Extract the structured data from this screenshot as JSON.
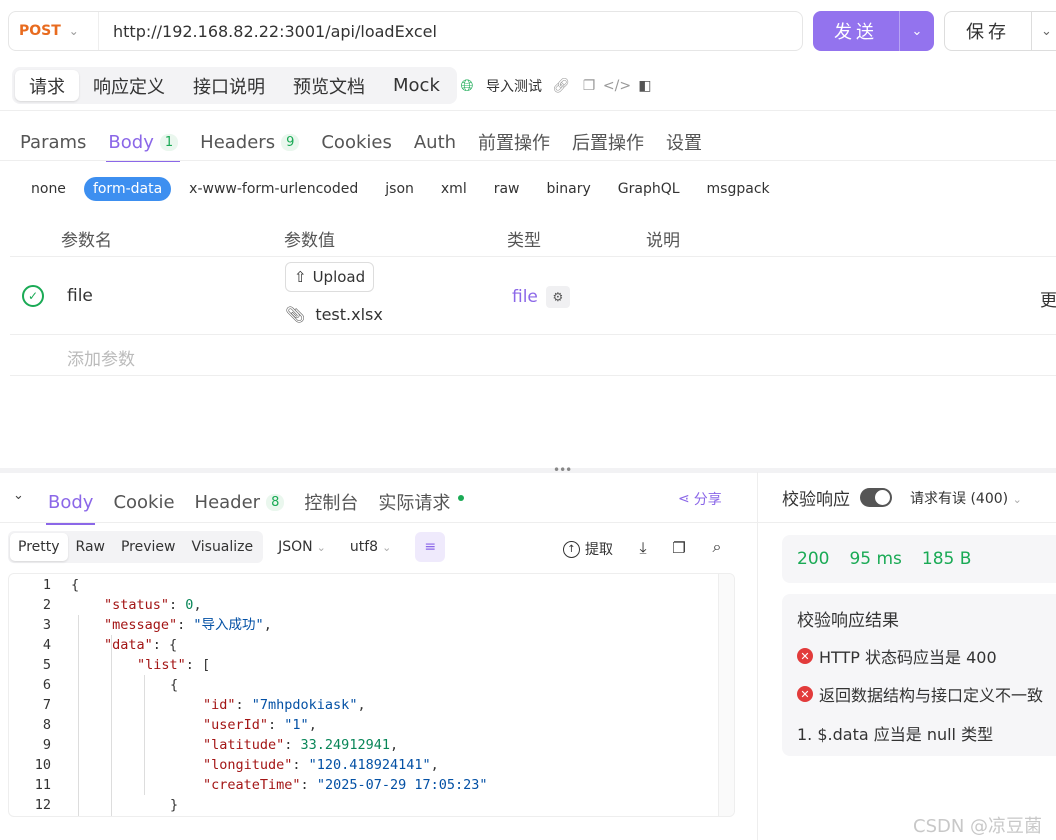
{
  "request": {
    "method": "POST",
    "url": "http://192.168.82.22:3001/api/loadExcel",
    "send_label": "发送",
    "save_label": "保存"
  },
  "mode_tabs": [
    "请求",
    "响应定义",
    "接口说明",
    "预览文档",
    "Mock"
  ],
  "tools": {
    "import_test": "导入测试"
  },
  "request_tabs": [
    {
      "label": "Params"
    },
    {
      "label": "Body",
      "count": "1"
    },
    {
      "label": "Headers",
      "count": "9"
    },
    {
      "label": "Cookies"
    },
    {
      "label": "Auth"
    },
    {
      "label": "前置操作"
    },
    {
      "label": "后置操作"
    },
    {
      "label": "设置"
    }
  ],
  "body_types": [
    "none",
    "form-data",
    "x-www-form-urlencoded",
    "json",
    "xml",
    "raw",
    "binary",
    "GraphQL",
    "msgpack"
  ],
  "params_table": {
    "headers": [
      "参数名",
      "参数值",
      "类型",
      "说明"
    ],
    "row": {
      "name": "file",
      "upload_label": "Upload",
      "file_name": "test.xlsx",
      "type": "file",
      "overflow_text": "更"
    },
    "add_placeholder": "添加参数"
  },
  "response": {
    "tabs": [
      {
        "label": "Body"
      },
      {
        "label": "Cookie"
      },
      {
        "label": "Header",
        "count": "8"
      },
      {
        "label": "控制台"
      },
      {
        "label": "实际请求"
      }
    ],
    "share_label": "分享",
    "view_tabs": [
      "Pretty",
      "Raw",
      "Preview",
      "Visualize"
    ],
    "format": "JSON",
    "encoding": "utf8",
    "extract_label": "提取",
    "code_lines": [
      {
        "n": "1",
        "indent": 0,
        "html": "{"
      },
      {
        "n": "2",
        "indent": 1,
        "key": "status",
        "num": "0",
        "tail": ","
      },
      {
        "n": "3",
        "indent": 1,
        "key": "message",
        "str": "导入成功",
        "tail": ","
      },
      {
        "n": "4",
        "indent": 1,
        "key": "data",
        "open": "{"
      },
      {
        "n": "5",
        "indent": 2,
        "key": "list",
        "open": "["
      },
      {
        "n": "6",
        "indent": 3,
        "html": "{"
      },
      {
        "n": "7",
        "indent": 4,
        "key": "id",
        "str": "7mhpdokiask",
        "tail": ","
      },
      {
        "n": "8",
        "indent": 4,
        "key": "userId",
        "str": "1",
        "tail": ","
      },
      {
        "n": "9",
        "indent": 4,
        "key": "latitude",
        "num": "33.24912941",
        "tail": ","
      },
      {
        "n": "10",
        "indent": 4,
        "key": "longitude",
        "str": "120.418924141",
        "tail": ","
      },
      {
        "n": "11",
        "indent": 4,
        "key": "createTime",
        "str": "2025-07-29 17:05:23",
        "tail": ""
      },
      {
        "n": "12",
        "indent": 3,
        "html": "}"
      }
    ]
  },
  "verify": {
    "title": "校验响应",
    "select_label": "请求有误 (400)",
    "status": "200",
    "time": "95 ms",
    "size": "185 B",
    "result_title": "校验响应结果",
    "errors": [
      "HTTP 状态码应当是 400",
      "返回数据结构与接口定义不一致"
    ],
    "detail": "1. $.data 应当是 null 类型"
  },
  "watermark": "CSDN @凉豆菌",
  "colors": {
    "accent": "#9373ee",
    "method": "#e86b1f",
    "success": "#1aaa55",
    "error": "#e23b3b",
    "form_data": "#3d8ff0"
  }
}
